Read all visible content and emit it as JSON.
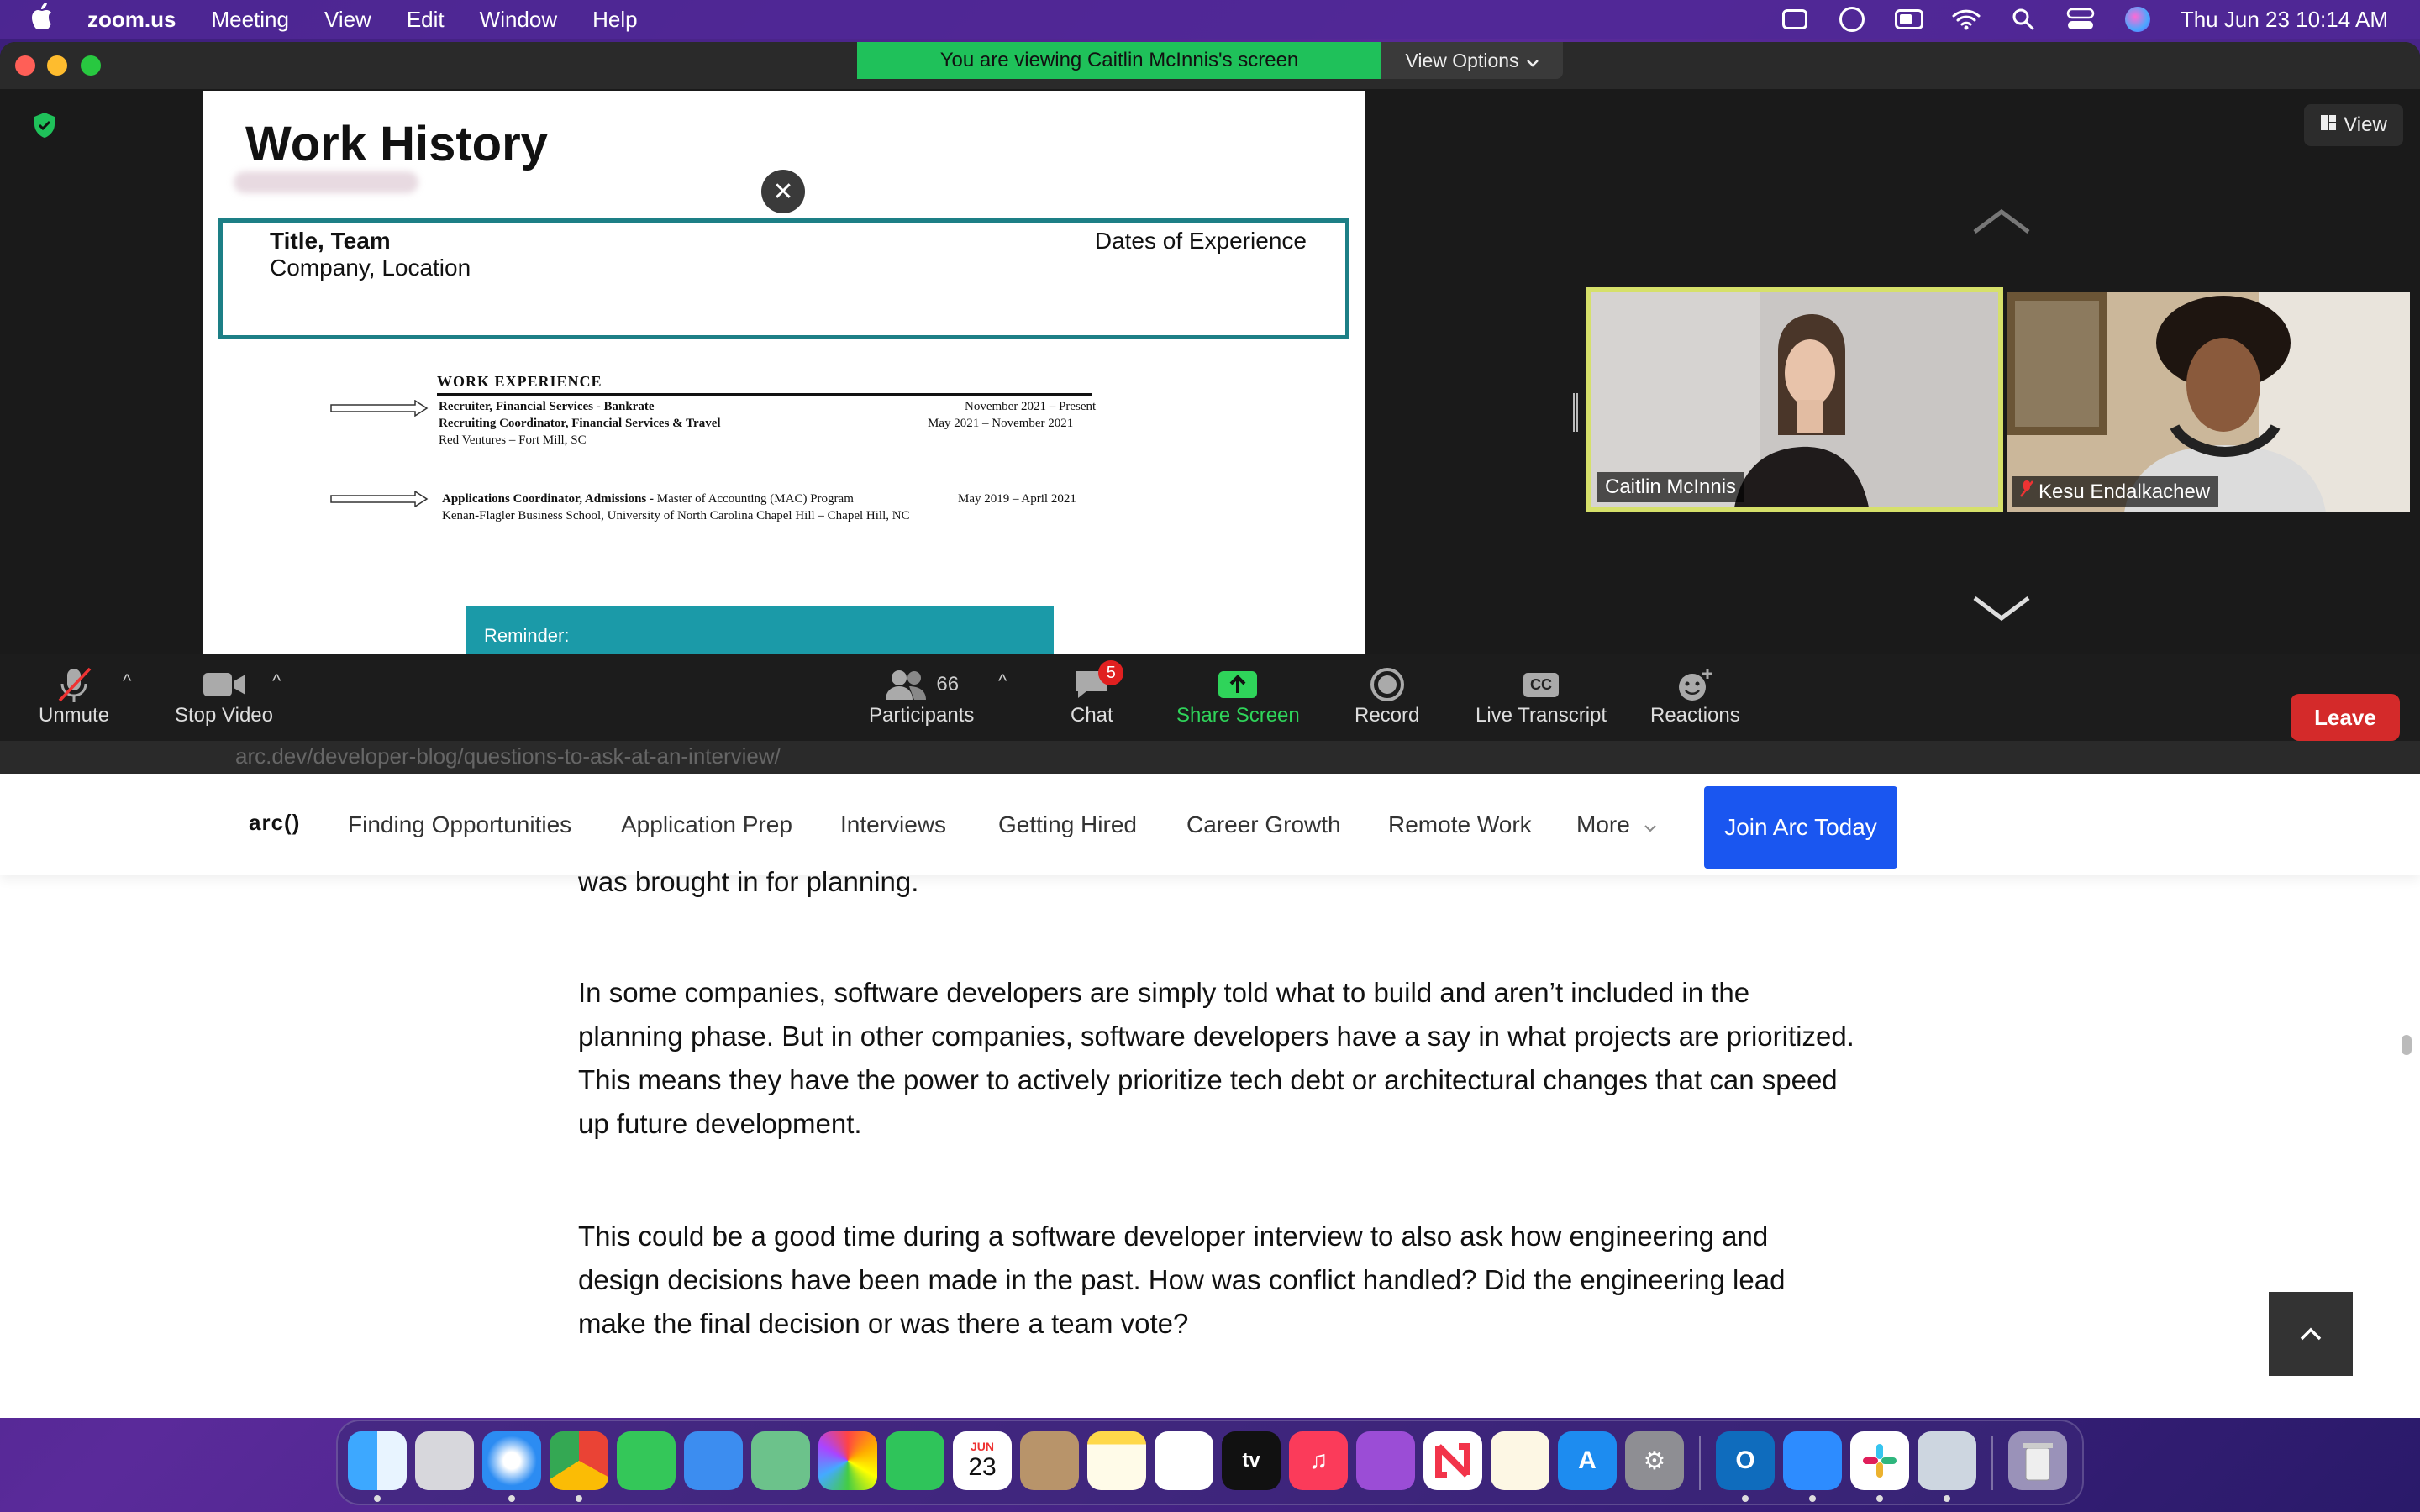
{
  "menubar": {
    "app_name": "zoom.us",
    "menus": [
      "Meeting",
      "View",
      "Edit",
      "Window",
      "Help"
    ],
    "clock": "Thu Jun 23  10:14 AM"
  },
  "zoom": {
    "viewing_banner": "You are viewing Caitlin McInnis's screen",
    "view_options": "View Options",
    "view_button": "View",
    "shared": {
      "title": "Work History",
      "box_title": "Title, Team",
      "box_company": "Company, Location",
      "box_dates": "Dates of Experience",
      "resume_heading": "WORK EXPERIENCE",
      "job1_title": "Recruiter, Financial Services - Bankrate",
      "job1_dates": "November 2021 – Present",
      "job2_title": "Recruiting Coordinator, Financial Services & Travel",
      "job2_dates": "May 2021 – November 2021",
      "job12_org": "Red Ventures – Fort Mill, SC",
      "job3_title": "Applications Coordinator, Admissions -",
      "job3_program": " Master of Accounting (MAC) Program",
      "job3_dates": "May 2019 – April 2021",
      "job3_org": "Kenan-Flagler Business School, University of North Carolina Chapel Hill – Chapel Hill, NC",
      "reminder": "Reminder:"
    },
    "participants_tiles": [
      {
        "name": "Caitlin McInnis"
      },
      {
        "name": "Kesu Endalkachew"
      }
    ],
    "toolbar": {
      "unmute": "Unmute",
      "stop_video": "Stop Video",
      "participants": "Participants",
      "participant_count": "66",
      "chat": "Chat",
      "chat_badge": "5",
      "share_screen": "Share Screen",
      "record": "Record",
      "live_transcript": "Live Transcript",
      "cc": "CC",
      "reactions": "Reactions",
      "leave": "Leave"
    },
    "url_hint": "arc.dev/developer-blog/questions-to-ask-at-an-interview/"
  },
  "arc": {
    "logo": "arc()",
    "nav": [
      "Finding Opportunities",
      "Application Prep",
      "Interviews",
      "Getting Hired",
      "Career Growth",
      "Remote Work",
      "More"
    ],
    "join": "Join Arc Today",
    "para0": "was brought in for planning.",
    "para1": "In some companies, software developers are simply told what to build and aren’t included in the planning phase. But in other companies, software developers have a say in what projects are prioritized. This means they have the power to actively prioritize tech debt or architectural changes that can speed up future development.",
    "para2": "This could be a good time during a software developer interview to also ask how engineering and design decisions have been made in the past. How was conflict handled? Did the engineering lead make the final decision or was there a team vote?"
  },
  "dock": {
    "calendar_month": "JUN",
    "calendar_day": "23",
    "tv_label": "tv"
  },
  "colors": {
    "zoom_green": "#1fc15a",
    "leave_red": "#d42a2a",
    "arc_blue": "#1a56f0",
    "teal": "#1d7f86",
    "active_speaker": "#d6e06a"
  }
}
